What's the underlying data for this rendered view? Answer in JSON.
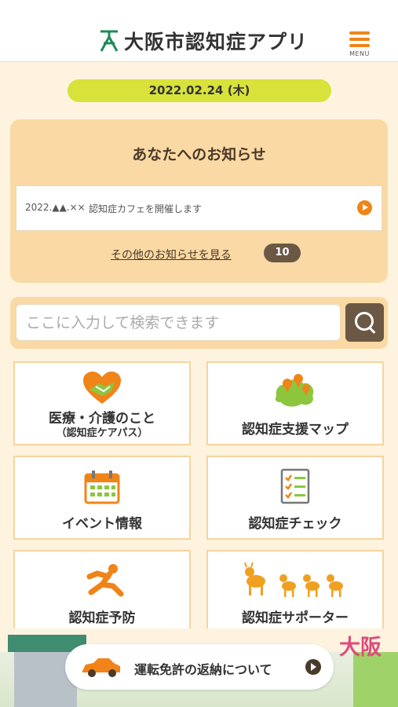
{
  "header": {
    "app_title": "大阪市認知症アプリ",
    "menu_label": "MENU",
    "logo_icon": "osaka-city-mark-icon",
    "menu_icon": "hamburger-icon"
  },
  "date": "2022.02.24 (木)",
  "notices": {
    "heading": "あなたへのお知らせ",
    "items": [
      {
        "date": "2022.▲▲.××",
        "text": "認知症カフェを開催します"
      }
    ],
    "more_label": "その他のお知らせを見る",
    "count": "10"
  },
  "search": {
    "placeholder": "ここに入力して検索できます",
    "button_icon": "search-icon"
  },
  "tiles": [
    {
      "label": "医療・介護のこと",
      "sub": "（認知症ケアパス）",
      "icon": "heart-hands-icon"
    },
    {
      "label": "認知症支援マップ",
      "icon": "map-pin-icon"
    },
    {
      "label": "イベント情報",
      "icon": "calendar-icon"
    },
    {
      "label": "認知症チェック",
      "icon": "checklist-icon"
    },
    {
      "label": "認知症予防",
      "icon": "stretching-person-icon"
    },
    {
      "label": "認知症サポーター",
      "icon": "deer-icon"
    }
  ],
  "license": {
    "label": "運転免許の返納について",
    "icon": "car-icon"
  },
  "footer_scene": {
    "city_label": "大阪"
  },
  "colors": {
    "accent": "#f08418",
    "date_pill": "#d9e23a",
    "panel": "#fbd9a4",
    "brown": "#6b5844",
    "background": "#fdf3df"
  }
}
